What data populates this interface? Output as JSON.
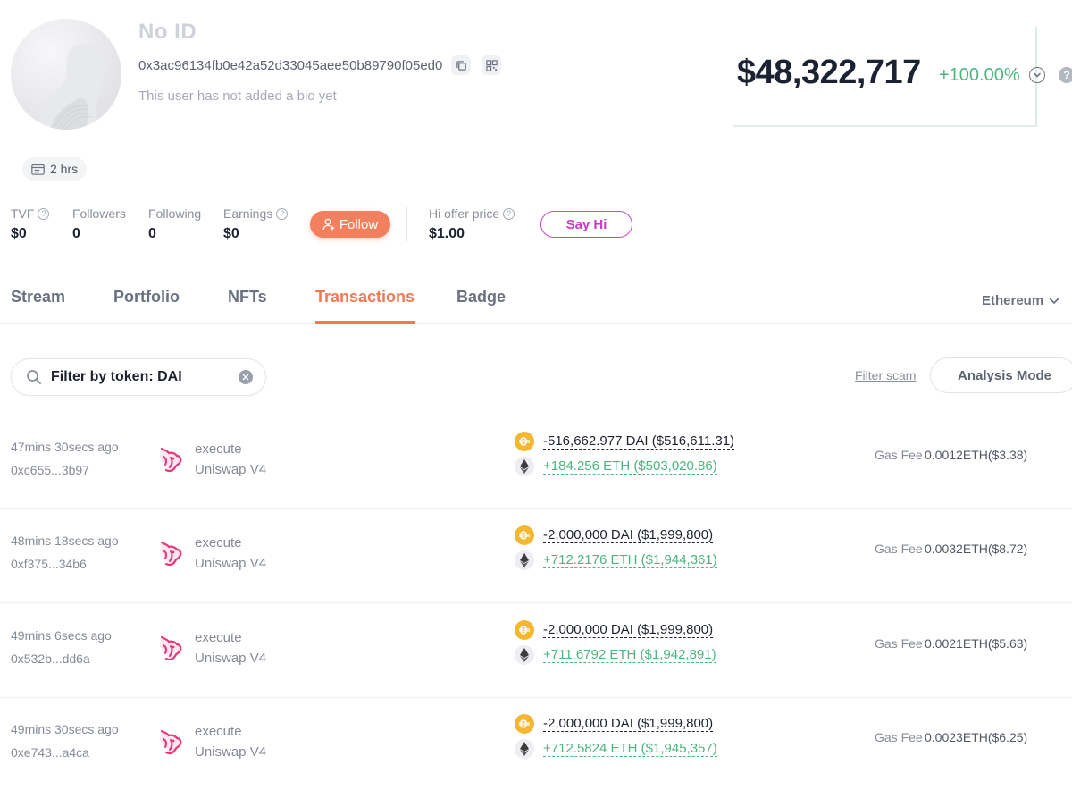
{
  "profile": {
    "name": "No ID",
    "address": "0x3ac96134fb0e42a52d33045aee50b89790f05ed0",
    "bio": "This user has not added a bio yet",
    "active_time": "2 hrs"
  },
  "portfolio": {
    "total_value": "$48,322,717",
    "change": "+100.00%"
  },
  "stats": {
    "tvf": {
      "label": "TVF",
      "value": "$0"
    },
    "followers": {
      "label": "Followers",
      "value": "0"
    },
    "following": {
      "label": "Following",
      "value": "0"
    },
    "earnings": {
      "label": "Earnings",
      "value": "$0"
    },
    "hi_offer": {
      "label": "Hi offer price",
      "value": "$1.00"
    }
  },
  "actions": {
    "follow_label": "Follow",
    "say_hi_label": "Say Hi"
  },
  "tabs": [
    {
      "label": "Stream"
    },
    {
      "label": "Portfolio"
    },
    {
      "label": "NFTs"
    },
    {
      "label": "Transactions"
    },
    {
      "label": "Badge"
    }
  ],
  "active_tab": "Transactions",
  "network": "Ethereum",
  "filter": {
    "search_value": "Filter by token: DAI",
    "filter_scam_label": "Filter scam",
    "analysis_mode_label": "Analysis Mode"
  },
  "transactions": [
    {
      "time": "47mins 30secs ago",
      "hash": "0xc655...3b97",
      "method": "execute",
      "protocol": "Uniswap V4",
      "out": "-516,662.977 DAI ($516,611.31)",
      "in": "+184.256 ETH ($503,020.86)",
      "gas_label": "Gas Fee",
      "gas": "0.0012ETH($3.38)"
    },
    {
      "time": "48mins 18secs ago",
      "hash": "0xf375...34b6",
      "method": "execute",
      "protocol": "Uniswap V4",
      "out": "-2,000,000 DAI ($1,999,800)",
      "in": "+712.2176 ETH ($1,944,361)",
      "gas_label": "Gas Fee",
      "gas": "0.0032ETH($8.72)"
    },
    {
      "time": "49mins 6secs ago",
      "hash": "0x532b...dd6a",
      "method": "execute",
      "protocol": "Uniswap V4",
      "out": "-2,000,000 DAI ($1,999,800)",
      "in": "+711.6792 ETH ($1,942,891)",
      "gas_label": "Gas Fee",
      "gas": "0.0021ETH($5.63)"
    },
    {
      "time": "49mins 30secs ago",
      "hash": "0xe743...a4ca",
      "method": "execute",
      "protocol": "Uniswap V4",
      "out": "-2,000,000 DAI ($1,999,800)",
      "in": "+712.5824 ETH ($1,945,357)",
      "gas_label": "Gas Fee",
      "gas": "0.0023ETH($6.25)"
    }
  ],
  "colors": {
    "accent": "#ef7a55",
    "positive": "#4bb57f",
    "say_hi": "#c43dc3",
    "dai": "#f4b731"
  },
  "icons": [
    "copy-icon",
    "qr-code-icon",
    "chevron-down-icon",
    "help-icon",
    "calendar-icon",
    "info-icon",
    "user-plus-icon",
    "search-icon",
    "clear-icon",
    "uniswap-logo",
    "dai-token-icon",
    "eth-token-icon"
  ]
}
